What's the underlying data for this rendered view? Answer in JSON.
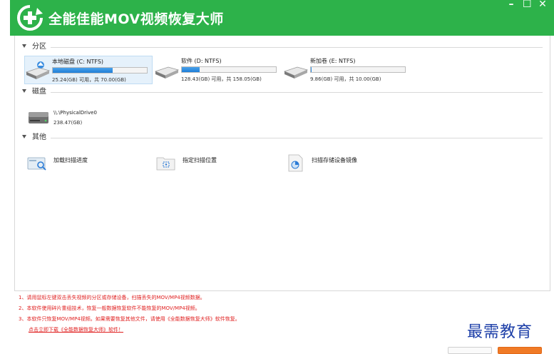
{
  "app": {
    "title": "全能佳能MOV视频恢复大师"
  },
  "window": {
    "minimize": "–",
    "restore": "☐",
    "close": "✕"
  },
  "sections": {
    "partitions": "分区",
    "disks": "磁盘",
    "others": "其他"
  },
  "partitions": [
    {
      "name": "本地磁盘 (C: NTFS)",
      "capacity": "25.24(GB) 可用，共 70.00(GB)",
      "used_fraction": 0.64,
      "selected": true
    },
    {
      "name": "软件 (D: NTFS)",
      "capacity": "128.43(GB) 可用，共 158.05(GB)",
      "used_fraction": 0.19,
      "selected": false
    },
    {
      "name": "新加卷 (E: NTFS)",
      "capacity": "9.86(GB) 可用，共 10.00(GB)",
      "used_fraction": 0.01,
      "selected": false
    }
  ],
  "disks": [
    {
      "name": "\\\\.\\PhysicalDrive0",
      "capacity": "238.47(GB)"
    }
  ],
  "tools": [
    {
      "label": "加载扫描进度",
      "icon": "load-scan-icon"
    },
    {
      "label": "指定扫描位置",
      "icon": "folder-target-icon"
    },
    {
      "label": "扫描存储设备镜像",
      "icon": "disk-image-icon"
    }
  ],
  "notes": [
    "1、请用鼠标左键双击丢失视频的分区或存储设备，扫描丢失的MOV/MP4视频数据。",
    "2、本软件使用碎片重组技术，恢复一般数据恢复软件不能恢复的MOV/MP4视频。",
    "3、本软件只恢复MOV/MP4视频。如果需要恢复其他文件，请使用《全能数据恢复大师》软件恢复。"
  ],
  "download_link": "点击立即下载《全能数据恢复大师》软件！",
  "watermark": "最需教育",
  "colors": {
    "titlebar": "#2db24a",
    "note_red": "#e02020",
    "accent_orange": "#f07a26"
  }
}
